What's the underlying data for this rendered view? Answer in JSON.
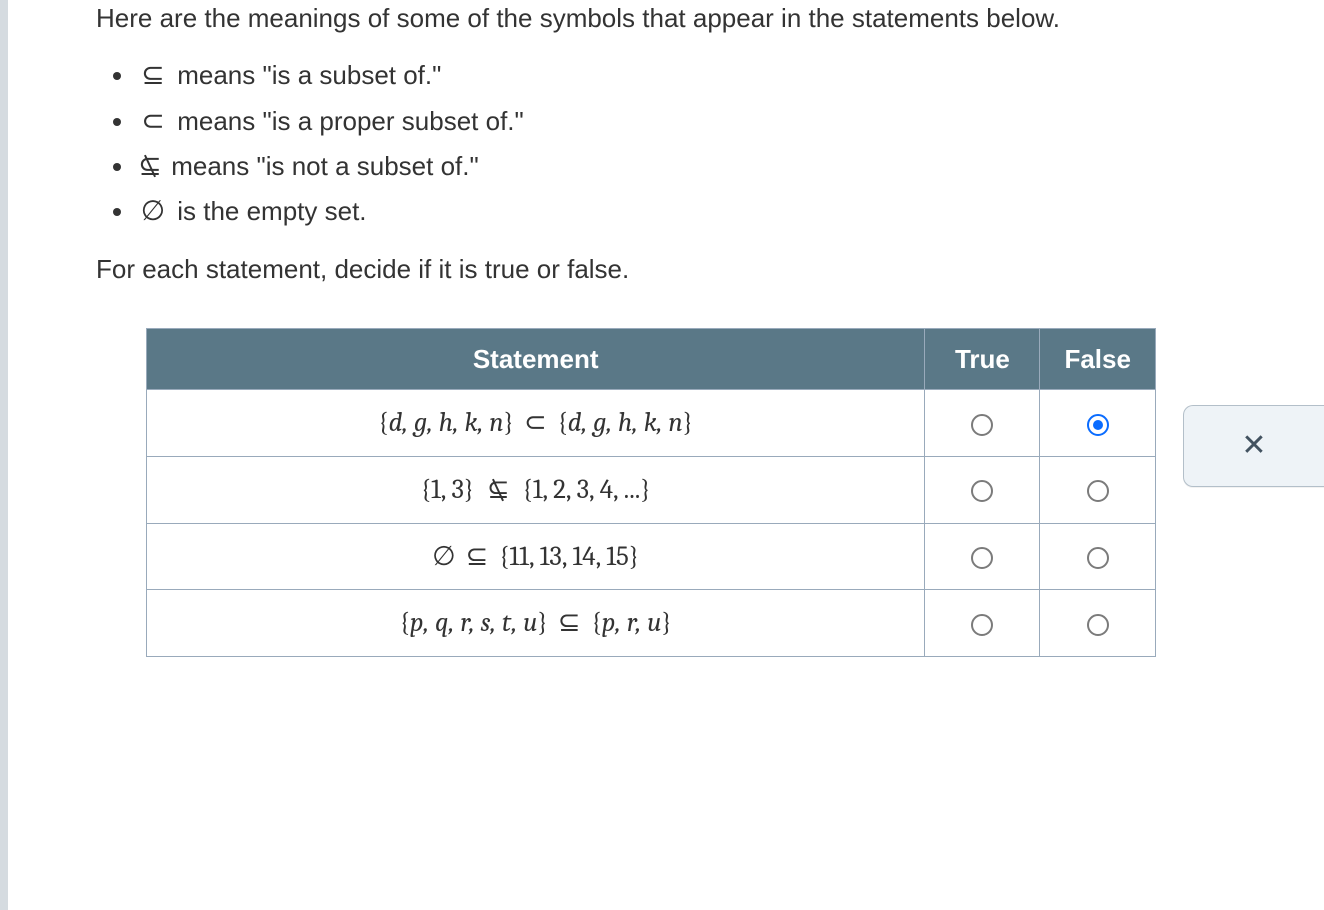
{
  "intro": "Here are the meanings of some of the symbols that appear in the statements below.",
  "legend": {
    "items": [
      {
        "symbol": "⊆",
        "text": " means \"is a subset of.\""
      },
      {
        "symbol": "⊂",
        "text": " means \"is a proper subset of.\""
      },
      {
        "symbol": "⊆",
        "slash": true,
        "text": " means \"is not a subset of.\""
      },
      {
        "symbol": "∅",
        "text": " is the empty set."
      }
    ]
  },
  "prompt": "For each statement, decide if it is true or false.",
  "table": {
    "headers": {
      "stmt": "Statement",
      "true": "True",
      "false": "False"
    },
    "rows": [
      {
        "left_vars": "d, g, h, k, n",
        "rel": "⊂",
        "rel_slash": false,
        "right_vars": "d, g, h, k, n",
        "italic_left": true,
        "italic_right": true,
        "true_selected": false,
        "false_selected": true
      },
      {
        "left_vars": "1, 3",
        "rel": "⊆",
        "rel_slash": true,
        "right_vars": "1, 2, 3, 4, ...",
        "italic_left": false,
        "italic_right": false,
        "true_selected": false,
        "false_selected": false
      },
      {
        "left_vars": "",
        "left_raw": "∅",
        "rel": "⊆",
        "rel_slash": false,
        "right_vars": "11, 13, 14, 15",
        "italic_left": false,
        "italic_right": false,
        "true_selected": false,
        "false_selected": false
      },
      {
        "left_vars": "p, q, r, s, t, u",
        "rel": "⊆",
        "rel_slash": false,
        "right_vars": "p, r, u",
        "italic_left": true,
        "italic_right": true,
        "true_selected": false,
        "false_selected": false
      }
    ]
  },
  "side": {
    "close_glyph": "✕"
  }
}
